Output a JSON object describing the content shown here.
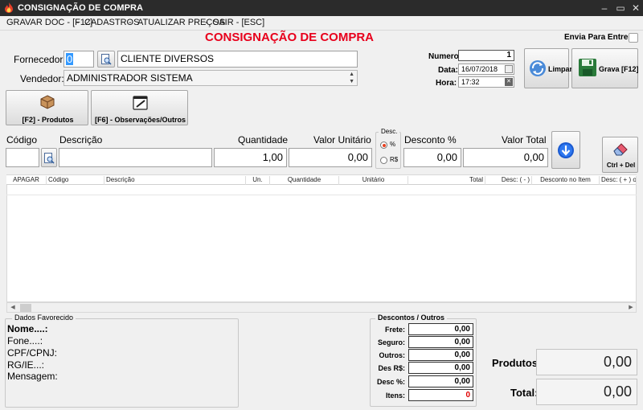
{
  "window": {
    "title": "CONSIGNAÇÃO DE COMPRA"
  },
  "menu": [
    "GRAVAR DOC - [F12]",
    "-",
    "CADASTROS",
    "-",
    "ATUALIZAR PREÇOS",
    "-",
    "SAIR - [ESC]"
  ],
  "form": {
    "heading": "CONSIGNAÇÃO DE COMPRA",
    "envia_label": "Envia Para Entrega",
    "fornecedor_label": "Fornecedor:",
    "fornecedor_code": "0",
    "fornecedor_name": "CLIENTE DIVERSOS",
    "vendedor_label": "Vendedor:",
    "vendedor_value": "ADMINISTRADOR SISTEMA",
    "numero_label": "Numero:",
    "numero_value": "1",
    "data_label": "Data:",
    "data_value": "16/07/2018",
    "hora_label": "Hora:",
    "hora_value": "17:32"
  },
  "buttons": {
    "limpar": "Limpar",
    "grava": "Grava [F12]",
    "produtos": "[F2] - Produtos",
    "observacoes": "[F6] - Observações/Outros",
    "ctrl_del": "Ctrl + Del"
  },
  "entry": {
    "codigo_label": "Código",
    "descricao_label": "Descrição",
    "quantidade_label": "Quantidade",
    "quantidade_value": "1,00",
    "valor_unitario_label": "Valor Unitário",
    "valor_unitario_value": "0,00",
    "desc_group_label": "Desc.",
    "pct_label": "%",
    "rs_label": "R$",
    "desconto_label": "Desconto %",
    "desconto_value": "0,00",
    "valor_total_label": "Valor Total",
    "valor_total_value": "0,00"
  },
  "grid": {
    "columns": [
      "APAGAR",
      "Código",
      "Descrição",
      "Un.",
      "Quantidade",
      "Unitário",
      "Total",
      "Desc: ( - )",
      "Desconto no Item",
      "Desc: ( + ) o"
    ]
  },
  "favorecido": {
    "legend": "Dados Favorecido",
    "nome": "Nome....:",
    "fone": "Fone....:",
    "cpf": "CPF/CPNJ:",
    "rg": "RG/IE...:",
    "mensagem": "Mensagem:"
  },
  "descontos": {
    "legend": "Descontos / Outros",
    "rows": [
      {
        "label": "Frete:",
        "value": "0,00"
      },
      {
        "label": "Seguro:",
        "value": "0,00"
      },
      {
        "label": "Outros:",
        "value": "0,00"
      },
      {
        "label": "Des R$:",
        "value": "0,00"
      },
      {
        "label": "Desc %:",
        "value": "0,00"
      },
      {
        "label": "Itens:",
        "value": "0"
      }
    ]
  },
  "totals": {
    "produtos_label": "Produtos:",
    "produtos_value": "0,00",
    "total_label": "Total:",
    "total_value": "0,00"
  },
  "colors": {
    "heading": "#e8001c",
    "titlebar": "#2b2b2b",
    "itens_value": "#e00000"
  }
}
